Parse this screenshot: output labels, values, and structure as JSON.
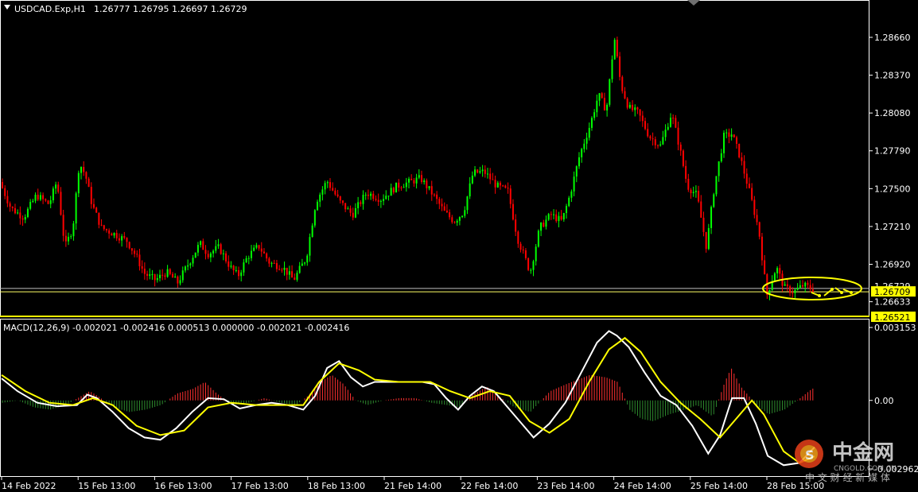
{
  "header": {
    "arrow_icon": "triangle-down-icon",
    "symbol_text": "USDCAD.Exp,H1",
    "ohlc_text": "1.26777 1.26795 1.26697 1.26729"
  },
  "macd_header": {
    "text": "MACD(12,26,9) -0.002021 -0.002416 0.000513 0.000000 -0.002021 -0.002416"
  },
  "watermark": {
    "icon": "cngold-logo-icon",
    "cn_title": "中金网",
    "url": "CNGOLD.COM.CN",
    "slogan": "中 文 财 经 新 媒 体"
  },
  "colors": {
    "background": "#000000",
    "bull": "#00ff00",
    "bear": "#ff0000",
    "signal": "#ffff00",
    "macd_line": "#ffffff",
    "hist_pos": "#ff3030",
    "hist_neg": "#2e8b2e",
    "hline": "#c0c0c0",
    "axis": "#ffffff"
  },
  "chart_data": [
    {
      "type": "candlestick",
      "title": "USDCAD.Exp,H1",
      "ylim": [
        1.26521,
        1.288
      ],
      "price_ticks": [
        "1.28660",
        "1.28370",
        "1.28080",
        "1.27790",
        "1.27500",
        "1.27210",
        "1.26920",
        "1.26633"
      ],
      "price_tick_values": [
        1.2866,
        1.2837,
        1.2808,
        1.2779,
        1.275,
        1.2721,
        1.2692,
        1.26633
      ],
      "current_price_label": "1.26709",
      "current_price": 1.26709,
      "hidden_price_label": "1.26729",
      "low_line_label": "1.26521",
      "low_line": 1.26521,
      "horizontal_lines": [
        1.26735,
        1.26709
      ],
      "x_labels": [
        "14 Feb 2022",
        "15 Feb 13:00",
        "16 Feb 13:00",
        "17 Feb 13:00",
        "18 Feb 13:00",
        "21 Feb 14:00",
        "22 Feb 14:00",
        "23 Feb 14:00",
        "24 Feb 14:00",
        "25 Feb 14:00",
        "28 Feb 15:00"
      ],
      "path_points": [
        [
          0,
          1.2755
        ],
        [
          14,
          1.2735
        ],
        [
          30,
          1.2728
        ],
        [
          46,
          1.2745
        ],
        [
          62,
          1.2738
        ],
        [
          72,
          1.2756
        ],
        [
          82,
          1.2705
        ],
        [
          92,
          1.272
        ],
        [
          100,
          1.277
        ],
        [
          108,
          1.276
        ],
        [
          116,
          1.2738
        ],
        [
          128,
          1.272
        ],
        [
          145,
          1.2715
        ],
        [
          160,
          1.271
        ],
        [
          172,
          1.2698
        ],
        [
          182,
          1.2685
        ],
        [
          196,
          1.268
        ],
        [
          210,
          1.2686
        ],
        [
          224,
          1.2678
        ],
        [
          238,
          1.2693
        ],
        [
          252,
          1.2708
        ],
        [
          262,
          1.27
        ],
        [
          276,
          1.2705
        ],
        [
          290,
          1.269
        ],
        [
          300,
          1.2683
        ],
        [
          312,
          1.2698
        ],
        [
          326,
          1.2706
        ],
        [
          340,
          1.2693
        ],
        [
          356,
          1.269
        ],
        [
          370,
          1.268
        ],
        [
          386,
          1.2697
        ],
        [
          398,
          1.274
        ],
        [
          412,
          1.2756
        ],
        [
          428,
          1.274
        ],
        [
          444,
          1.273
        ],
        [
          462,
          1.2747
        ],
        [
          480,
          1.2742
        ],
        [
          500,
          1.2752
        ],
        [
          516,
          1.2755
        ],
        [
          530,
          1.2758
        ],
        [
          546,
          1.2745
        ],
        [
          560,
          1.2732
        ],
        [
          572,
          1.2725
        ],
        [
          584,
          1.2732
        ],
        [
          596,
          1.2762
        ],
        [
          610,
          1.2763
        ],
        [
          626,
          1.2752
        ],
        [
          640,
          1.2748
        ],
        [
          652,
          1.2712
        ],
        [
          668,
          1.2686
        ],
        [
          680,
          1.272
        ],
        [
          694,
          1.273
        ],
        [
          708,
          1.2725
        ],
        [
          718,
          1.2745
        ],
        [
          730,
          1.2775
        ],
        [
          744,
          1.28
        ],
        [
          754,
          1.2822
        ],
        [
          764,
          1.281
        ],
        [
          774,
          1.2866
        ],
        [
          782,
          1.283
        ],
        [
          792,
          1.2812
        ],
        [
          804,
          1.2808
        ],
        [
          818,
          1.279
        ],
        [
          832,
          1.2783
        ],
        [
          846,
          1.2808
        ],
        [
          856,
          1.2782
        ],
        [
          866,
          1.2752
        ],
        [
          878,
          1.2745
        ],
        [
          890,
          1.2705
        ],
        [
          900,
          1.2752
        ],
        [
          912,
          1.279
        ],
        [
          922,
          1.2792
        ],
        [
          932,
          1.2775
        ],
        [
          944,
          1.2748
        ],
        [
          956,
          1.2718
        ],
        [
          966,
          1.2668
        ],
        [
          978,
          1.269
        ],
        [
          988,
          1.2674
        ],
        [
          1000,
          1.2671
        ],
        [
          1012,
          1.2676
        ],
        [
          1024,
          1.26729
        ]
      ],
      "annotation": "yellow-ellipse-around-last-candles"
    },
    {
      "type": "line",
      "title": "MACD(12,26,9)",
      "ylim": [
        -0.002962,
        0.003153
      ],
      "y_ticks": [
        "0.003153",
        "0.00",
        "-0.002962"
      ],
      "y_tick_values": [
        0.003153,
        0.0,
        -0.002962
      ],
      "series": [
        {
          "name": "MACD",
          "values": [
            [
              0,
              0.00095
            ],
            [
              20,
              0.0004
            ],
            [
              45,
              -0.0001
            ],
            [
              70,
              -0.00025
            ],
            [
              95,
              -0.0002
            ],
            [
              108,
              0.00025
            ],
            [
              120,
              0.0001
            ],
            [
              140,
              -0.0005
            ],
            [
              160,
              -0.0012
            ],
            [
              180,
              -0.0016
            ],
            [
              200,
              -0.0017
            ],
            [
              220,
              -0.0012
            ],
            [
              240,
              -0.0005
            ],
            [
              260,
              0.0001
            ],
            [
              280,
              5e-05
            ],
            [
              300,
              -0.00035
            ],
            [
              320,
              -0.0002
            ],
            [
              340,
              -0.0001
            ],
            [
              360,
              -0.0002
            ],
            [
              380,
              -0.0004
            ],
            [
              395,
              0.0002
            ],
            [
              410,
              0.0014
            ],
            [
              425,
              0.0017
            ],
            [
              440,
              0.001
            ],
            [
              455,
              0.0006
            ],
            [
              470,
              0.0008
            ],
            [
              490,
              0.0008
            ],
            [
              510,
              0.0008
            ],
            [
              530,
              0.0008
            ],
            [
              545,
              0.0007
            ],
            [
              560,
              0.0001
            ],
            [
              575,
              -0.0004
            ],
            [
              590,
              0.0002
            ],
            [
              605,
              0.0006
            ],
            [
              620,
              0.0004
            ],
            [
              635,
              -0.0002
            ],
            [
              655,
              -0.001
            ],
            [
              670,
              -0.0016
            ],
            [
              690,
              -0.001
            ],
            [
              710,
              -0.0001
            ],
            [
              730,
              0.0012
            ],
            [
              750,
              0.0025
            ],
            [
              765,
              0.003
            ],
            [
              775,
              0.0028
            ],
            [
              790,
              0.0023
            ],
            [
              810,
              0.0012
            ],
            [
              830,
              0.0002
            ],
            [
              850,
              -0.0002
            ],
            [
              870,
              -0.0011
            ],
            [
              890,
              -0.0023
            ],
            [
              905,
              -0.0015
            ],
            [
              920,
              0.0001
            ],
            [
              935,
              0.0001
            ],
            [
              950,
              -0.001
            ],
            [
              965,
              -0.0024
            ],
            [
              985,
              -0.0028
            ],
            [
              1005,
              -0.0027
            ],
            [
              1024,
              -0.002021
            ]
          ]
        },
        {
          "name": "Signal",
          "values": [
            [
              0,
              0.0011
            ],
            [
              30,
              0.0004
            ],
            [
              60,
              -0.0001
            ],
            [
              90,
              -0.0002
            ],
            [
              115,
              0.0001
            ],
            [
              140,
              -0.0002
            ],
            [
              170,
              -0.0011
            ],
            [
              200,
              -0.0015
            ],
            [
              230,
              -0.0013
            ],
            [
              260,
              -0.0003
            ],
            [
              290,
              -0.0001
            ],
            [
              320,
              -0.0002
            ],
            [
              350,
              -0.0002
            ],
            [
              380,
              -0.0002
            ],
            [
              400,
              0.0008
            ],
            [
              425,
              0.0016
            ],
            [
              450,
              0.0013
            ],
            [
              470,
              0.0009
            ],
            [
              500,
              0.0008
            ],
            [
              540,
              0.0008
            ],
            [
              565,
              0.0004
            ],
            [
              590,
              0.0001
            ],
            [
              615,
              0.0004
            ],
            [
              640,
              0.0002
            ],
            [
              665,
              -0.0009
            ],
            [
              690,
              -0.0014
            ],
            [
              715,
              -0.0008
            ],
            [
              740,
              0.0008
            ],
            [
              765,
              0.0022
            ],
            [
              785,
              0.0027
            ],
            [
              805,
              0.0021
            ],
            [
              830,
              0.0008
            ],
            [
              855,
              -0.0001
            ],
            [
              880,
              -0.0008
            ],
            [
              905,
              -0.0016
            ],
            [
              925,
              -0.0008
            ],
            [
              945,
              0.0
            ],
            [
              960,
              -0.0006
            ],
            [
              985,
              -0.0022
            ],
            [
              1005,
              -0.0027
            ],
            [
              1024,
              -0.002416
            ]
          ]
        },
        {
          "name": "Histogram",
          "values": [
            [
              0,
              -0.0001
            ],
            [
              20,
              0.0
            ],
            [
              40,
              -0.0003
            ],
            [
              60,
              -0.0004
            ],
            [
              80,
              -0.0002
            ],
            [
              100,
              0.0002
            ],
            [
              110,
              0.0004
            ],
            [
              120,
              0.0002
            ],
            [
              140,
              -0.0003
            ],
            [
              160,
              -0.0005
            ],
            [
              180,
              -0.0004
            ],
            [
              200,
              -0.0002
            ],
            [
              220,
              0.0003
            ],
            [
              240,
              0.0005
            ],
            [
              255,
              0.0008
            ],
            [
              270,
              0.0003
            ],
            [
              290,
              -0.0002
            ],
            [
              310,
              -0.0001
            ],
            [
              330,
              0.0001
            ],
            [
              350,
              -0.0001
            ],
            [
              370,
              -0.0002
            ],
            [
              385,
              0.0002
            ],
            [
              400,
              0.0008
            ],
            [
              415,
              0.0011
            ],
            [
              430,
              0.0007
            ],
            [
              445,
              0.0
            ],
            [
              460,
              -0.0002
            ],
            [
              480,
              0.0
            ],
            [
              500,
              0.0001
            ],
            [
              520,
              0.0001
            ],
            [
              540,
              -0.0001
            ],
            [
              560,
              -0.0002
            ],
            [
              575,
              -0.0003
            ],
            [
              590,
              0.0002
            ],
            [
              610,
              0.0006
            ],
            [
              625,
              0.0002
            ],
            [
              645,
              -0.0003
            ],
            [
              665,
              -0.0005
            ],
            [
              690,
              0.0004
            ],
            [
              710,
              0.0007
            ],
            [
              740,
              0.0011
            ],
            [
              760,
              0.001
            ],
            [
              775,
              0.0008
            ],
            [
              790,
              -0.0004
            ],
            [
              805,
              -0.0008
            ],
            [
              820,
              -0.0009
            ],
            [
              840,
              -0.0006
            ],
            [
              860,
              -0.0004
            ],
            [
              875,
              -0.0002
            ],
            [
              895,
              -0.0007
            ],
            [
              910,
              0.0008
            ],
            [
              918,
              0.0014
            ],
            [
              930,
              0.0006
            ],
            [
              950,
              -0.0002
            ],
            [
              965,
              -0.0006
            ],
            [
              985,
              -0.0004
            ],
            [
              1005,
              0.0001
            ],
            [
              1020,
              0.00051
            ]
          ]
        }
      ]
    }
  ]
}
